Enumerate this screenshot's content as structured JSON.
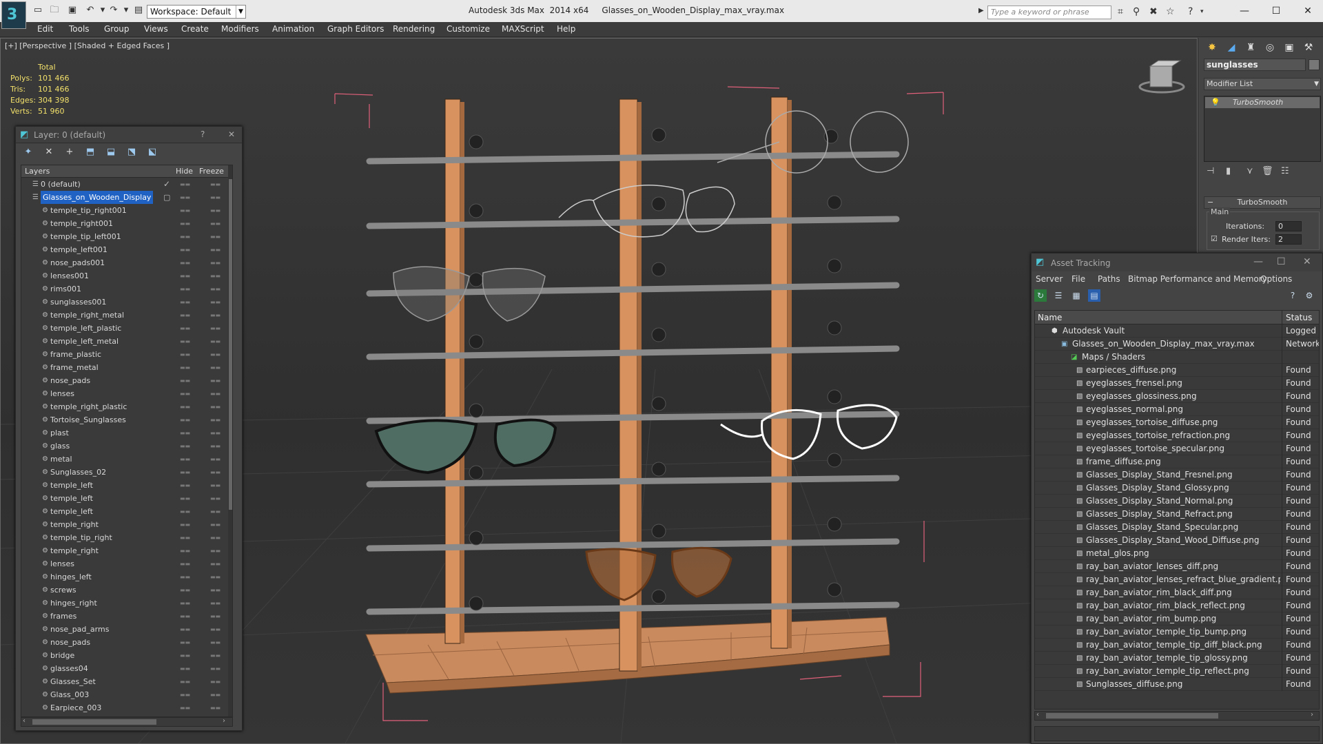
{
  "app": {
    "title": "Autodesk 3ds Max  2014 x64     Glasses_on_Wooden_Display_max_vray.max",
    "workspace": "Workspace: Default",
    "search_placeholder": "Type a keyword or phrase"
  },
  "menu": [
    "Edit",
    "Tools",
    "Group",
    "Views",
    "Create",
    "Modifiers",
    "Animation",
    "Graph Editors",
    "Rendering",
    "Customize",
    "MAXScript",
    "Help"
  ],
  "viewport": {
    "label": "[+] [Perspective ] [Shaded + Edged Faces ]",
    "stats_header": "Total",
    "stats": [
      {
        "label": "Polys:",
        "value": "101 466"
      },
      {
        "label": "Tris:",
        "value": "101 466"
      },
      {
        "label": "Edges:",
        "value": "304 398"
      },
      {
        "label": "Verts:",
        "value": "51 960"
      }
    ]
  },
  "layer_panel": {
    "title": "Layer: 0 (default)",
    "help": "?",
    "close": "✕",
    "columns": {
      "layers": "Layers",
      "hide": "Hide",
      "freeze": "Freeze"
    },
    "root_layers": [
      {
        "name": "0 (default)",
        "active": true
      },
      {
        "name": "Glasses_on_Wooden_Display",
        "selected": true
      }
    ],
    "objects": [
      "temple_tip_right001",
      "temple_right001",
      "temple_tip_left001",
      "temple_left001",
      "nose_pads001",
      "lenses001",
      "rims001",
      "sunglasses001",
      "temple_right_metal",
      "temple_left_plastic",
      "temple_left_metal",
      "frame_plastic",
      "frame_metal",
      "nose_pads",
      "lenses",
      "temple_right_plastic",
      "Tortoise_Sunglasses",
      "plast",
      "glass",
      "metal",
      "Sunglasses_02",
      "temple_left",
      "temple_left",
      "temple_left",
      "temple_right",
      "temple_tip_right",
      "temple_right",
      "lenses",
      "hinges_left",
      "screws",
      "hinges_right",
      "frames",
      "nose_pad_arms",
      "nose_pads",
      "bridge",
      "glasses04",
      "Glasses_Set",
      "Glass_003",
      "Earpiece_003"
    ]
  },
  "command_panel": {
    "object_name": "sunglasses",
    "modifier_list": "Modifier List",
    "stack": [
      "TurboSmooth"
    ],
    "rollout": "TurboSmooth",
    "group": "Main",
    "iterations_label": "Iterations:",
    "iterations_value": "0",
    "render_iters_label": "Render Iters:",
    "render_iters_value": "2"
  },
  "asset_panel": {
    "title": "Asset Tracking",
    "menu": [
      "Server",
      "File",
      "Paths",
      "Bitmap Performance and Memory",
      "Options"
    ],
    "columns": {
      "name": "Name",
      "status": "Status"
    },
    "vault": {
      "name": "Autodesk Vault",
      "status": "Logged"
    },
    "file": {
      "name": "Glasses_on_Wooden_Display_max_vray.max",
      "status": "Network"
    },
    "group": {
      "name": "Maps / Shaders",
      "status": ""
    },
    "maps": [
      {
        "name": "earpieces_diffuse.png",
        "status": "Found"
      },
      {
        "name": "eyeglasses_frensel.png",
        "status": "Found"
      },
      {
        "name": "eyeglasses_glossiness.png",
        "status": "Found"
      },
      {
        "name": "eyeglasses_normal.png",
        "status": "Found"
      },
      {
        "name": "eyeglasses_tortoise_diffuse.png",
        "status": "Found"
      },
      {
        "name": "eyeglasses_tortoise_refraction.png",
        "status": "Found"
      },
      {
        "name": "eyeglasses_tortoise_specular.png",
        "status": "Found"
      },
      {
        "name": "frame_diffuse.png",
        "status": "Found"
      },
      {
        "name": "Glasses_Display_Stand_Fresnel.png",
        "status": "Found"
      },
      {
        "name": "Glasses_Display_Stand_Glossy.png",
        "status": "Found"
      },
      {
        "name": "Glasses_Display_Stand_Normal.png",
        "status": "Found"
      },
      {
        "name": "Glasses_Display_Stand_Refract.png",
        "status": "Found"
      },
      {
        "name": "Glasses_Display_Stand_Specular.png",
        "status": "Found"
      },
      {
        "name": "Glasses_Display_Stand_Wood_Diffuse.png",
        "status": "Found"
      },
      {
        "name": "metal_glos.png",
        "status": "Found"
      },
      {
        "name": "ray_ban_aviator_lenses_diff.png",
        "status": "Found"
      },
      {
        "name": "ray_ban_aviator_lenses_refract_blue_gradient.png",
        "status": "Found"
      },
      {
        "name": "ray_ban_aviator_rim_black_diff.png",
        "status": "Found"
      },
      {
        "name": "ray_ban_aviator_rim_black_reflect.png",
        "status": "Found"
      },
      {
        "name": "ray_ban_aviator_rim_bump.png",
        "status": "Found"
      },
      {
        "name": "ray_ban_aviator_temple_tip_bump.png",
        "status": "Found"
      },
      {
        "name": "ray_ban_aviator_temple_tip_diff_black.png",
        "status": "Found"
      },
      {
        "name": "ray_ban_aviator_temple_tip_glossy.png",
        "status": "Found"
      },
      {
        "name": "ray_ban_aviator_temple_tip_reflect.png",
        "status": "Found"
      },
      {
        "name": "Sunglasses_diffuse.png",
        "status": "Found"
      }
    ]
  }
}
